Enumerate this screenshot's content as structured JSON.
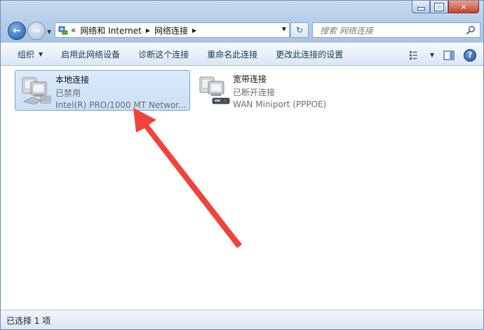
{
  "window": {
    "controls": {
      "minimize": "",
      "maximize": "",
      "close": "✕"
    }
  },
  "address_bar": {
    "prefix": "«",
    "crumbs": [
      "网络和 Internet",
      "网络连接"
    ]
  },
  "search": {
    "placeholder": "搜索 网络连接"
  },
  "toolbar": {
    "organize": "组织",
    "enable_device": "启用此网络设备",
    "diagnose": "诊断这个连接",
    "rename": "重命名此连接",
    "change_settings": "更改此连接的设置"
  },
  "connections": [
    {
      "name": "本地连接",
      "status": "已禁用",
      "device": "Intel(R) PRO/1000 MT Networ...",
      "selected": true
    },
    {
      "name": "宽带连接",
      "status": "已断开连接",
      "device": "WAN Miniport (PPPOE)",
      "selected": false
    }
  ],
  "statusbar": {
    "text": "已选择 1 项"
  },
  "colors": {
    "annotation_arrow": "#f0433a",
    "selection": "#c9dff7",
    "accent": "#1c55a8"
  }
}
